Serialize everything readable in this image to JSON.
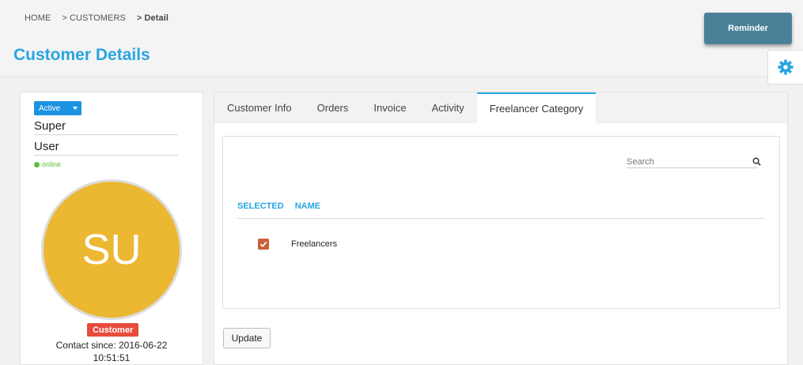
{
  "breadcrumb": {
    "items": [
      "HOME",
      "CUSTOMERS",
      "Detail"
    ],
    "separator": ">"
  },
  "page_title": "Customer Details",
  "reminder_label": "Reminder",
  "profile": {
    "status": "Active",
    "first_name": "Super",
    "last_name": "User",
    "presence": "online",
    "initials": "SU",
    "role": "Customer",
    "contact_since_line1": "Contact since: 2016-06-22",
    "contact_since_line2": "10:51:51"
  },
  "tabs": [
    "Customer Info",
    "Orders",
    "Invoice",
    "Activity",
    "Freelancer Category"
  ],
  "active_tab": "Freelancer Category",
  "search": {
    "placeholder": "Search"
  },
  "table": {
    "headers": [
      "SELECTED",
      "NAME"
    ],
    "rows": [
      {
        "selected": true,
        "name": "Freelancers"
      }
    ]
  },
  "update_label": "Update",
  "colors": {
    "accent": "#29a5e0",
    "reminder": "#4a8199",
    "avatar": "#ecb731",
    "role_badge": "#e84b3c",
    "online": "#5bbf3a",
    "checkbox": "#c8603a"
  },
  "icons": [
    "gear-icon",
    "search-icon",
    "check-icon",
    "caret-down-icon"
  ]
}
